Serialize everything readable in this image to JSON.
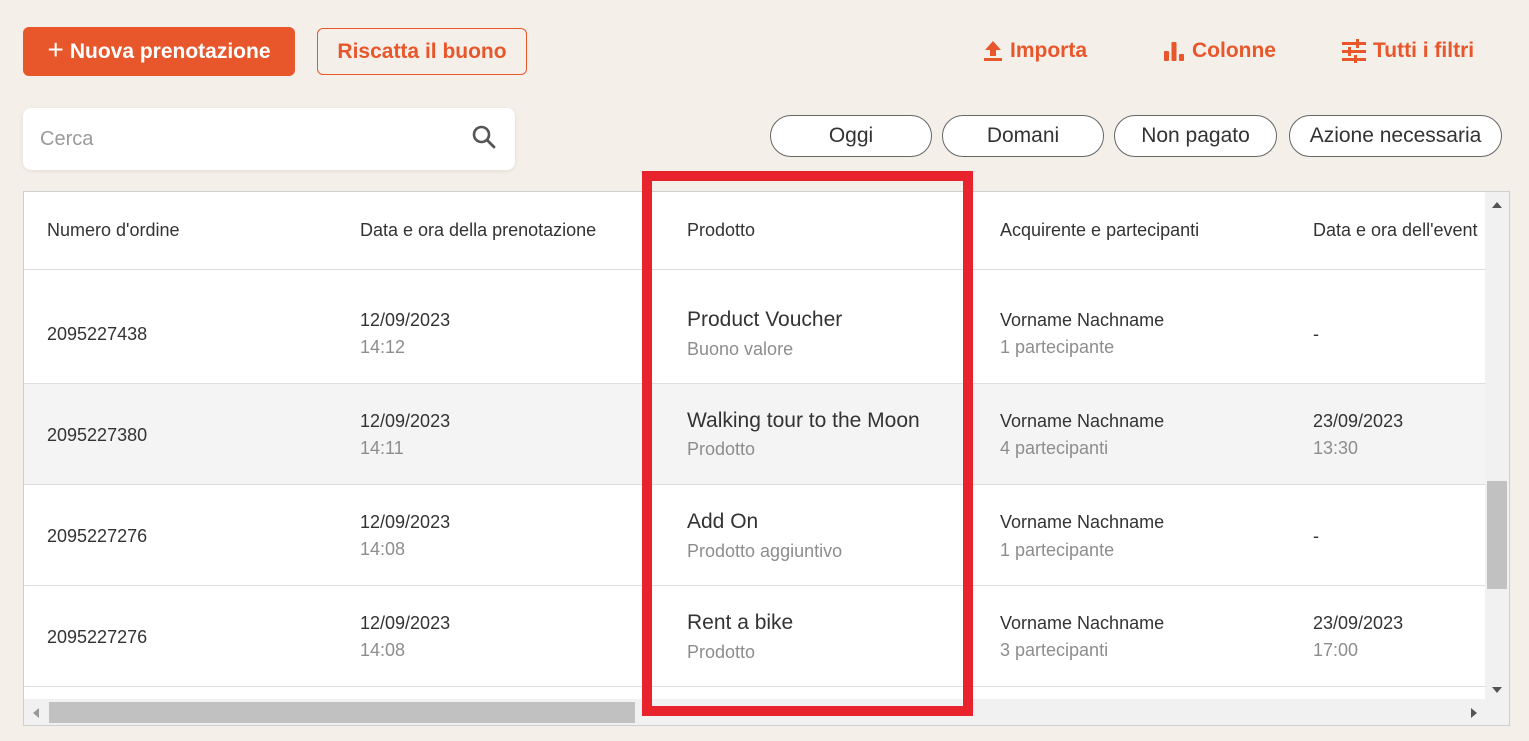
{
  "toolbar": {
    "new_booking_label": "Nuova prenotazione",
    "redeem_voucher_label": "Riscatta il buono",
    "import_label": "Importa",
    "columns_label": "Colonne",
    "all_filters_label": "Tutti i filtri"
  },
  "search": {
    "placeholder": "Cerca",
    "value": ""
  },
  "filters": [
    "Oggi",
    "Domani",
    "Non pagato",
    "Azione necessaria"
  ],
  "table": {
    "columns": [
      "Numero d'ordine",
      "Data e ora della prenotazione",
      "Prodotto",
      "Acquirente e partecipanti",
      "Data e ora dell'event"
    ],
    "rows": [
      {
        "order": "2095227438",
        "booking_date": "12/09/2023",
        "booking_time": "14:12",
        "product": "Product Voucher",
        "product_type": "Buono valore",
        "buyer": "Vorname Nachname",
        "participants": "1 partecipante",
        "event_date": "-",
        "event_time": ""
      },
      {
        "order": "2095227380",
        "booking_date": "12/09/2023",
        "booking_time": "14:11",
        "product": "Walking tour to the Moon",
        "product_type": "Prodotto",
        "buyer": "Vorname Nachname",
        "participants": "4 partecipanti",
        "event_date": "23/09/2023",
        "event_time": "13:30"
      },
      {
        "order": "2095227276",
        "booking_date": "12/09/2023",
        "booking_time": "14:08",
        "product": "Add On",
        "product_type": "Prodotto aggiuntivo",
        "buyer": "Vorname Nachname",
        "participants": "1 partecipante",
        "event_date": "-",
        "event_time": ""
      },
      {
        "order": "2095227276",
        "booking_date": "12/09/2023",
        "booking_time": "14:08",
        "product": "Rent a bike",
        "product_type": "Prodotto",
        "buyer": "Vorname Nachname",
        "participants": "3 partecipanti",
        "event_date": "23/09/2023",
        "event_time": "17:00"
      }
    ]
  },
  "colors": {
    "accent": "#e8572b",
    "highlight": "#e8232e",
    "background": "#f4efe9"
  }
}
